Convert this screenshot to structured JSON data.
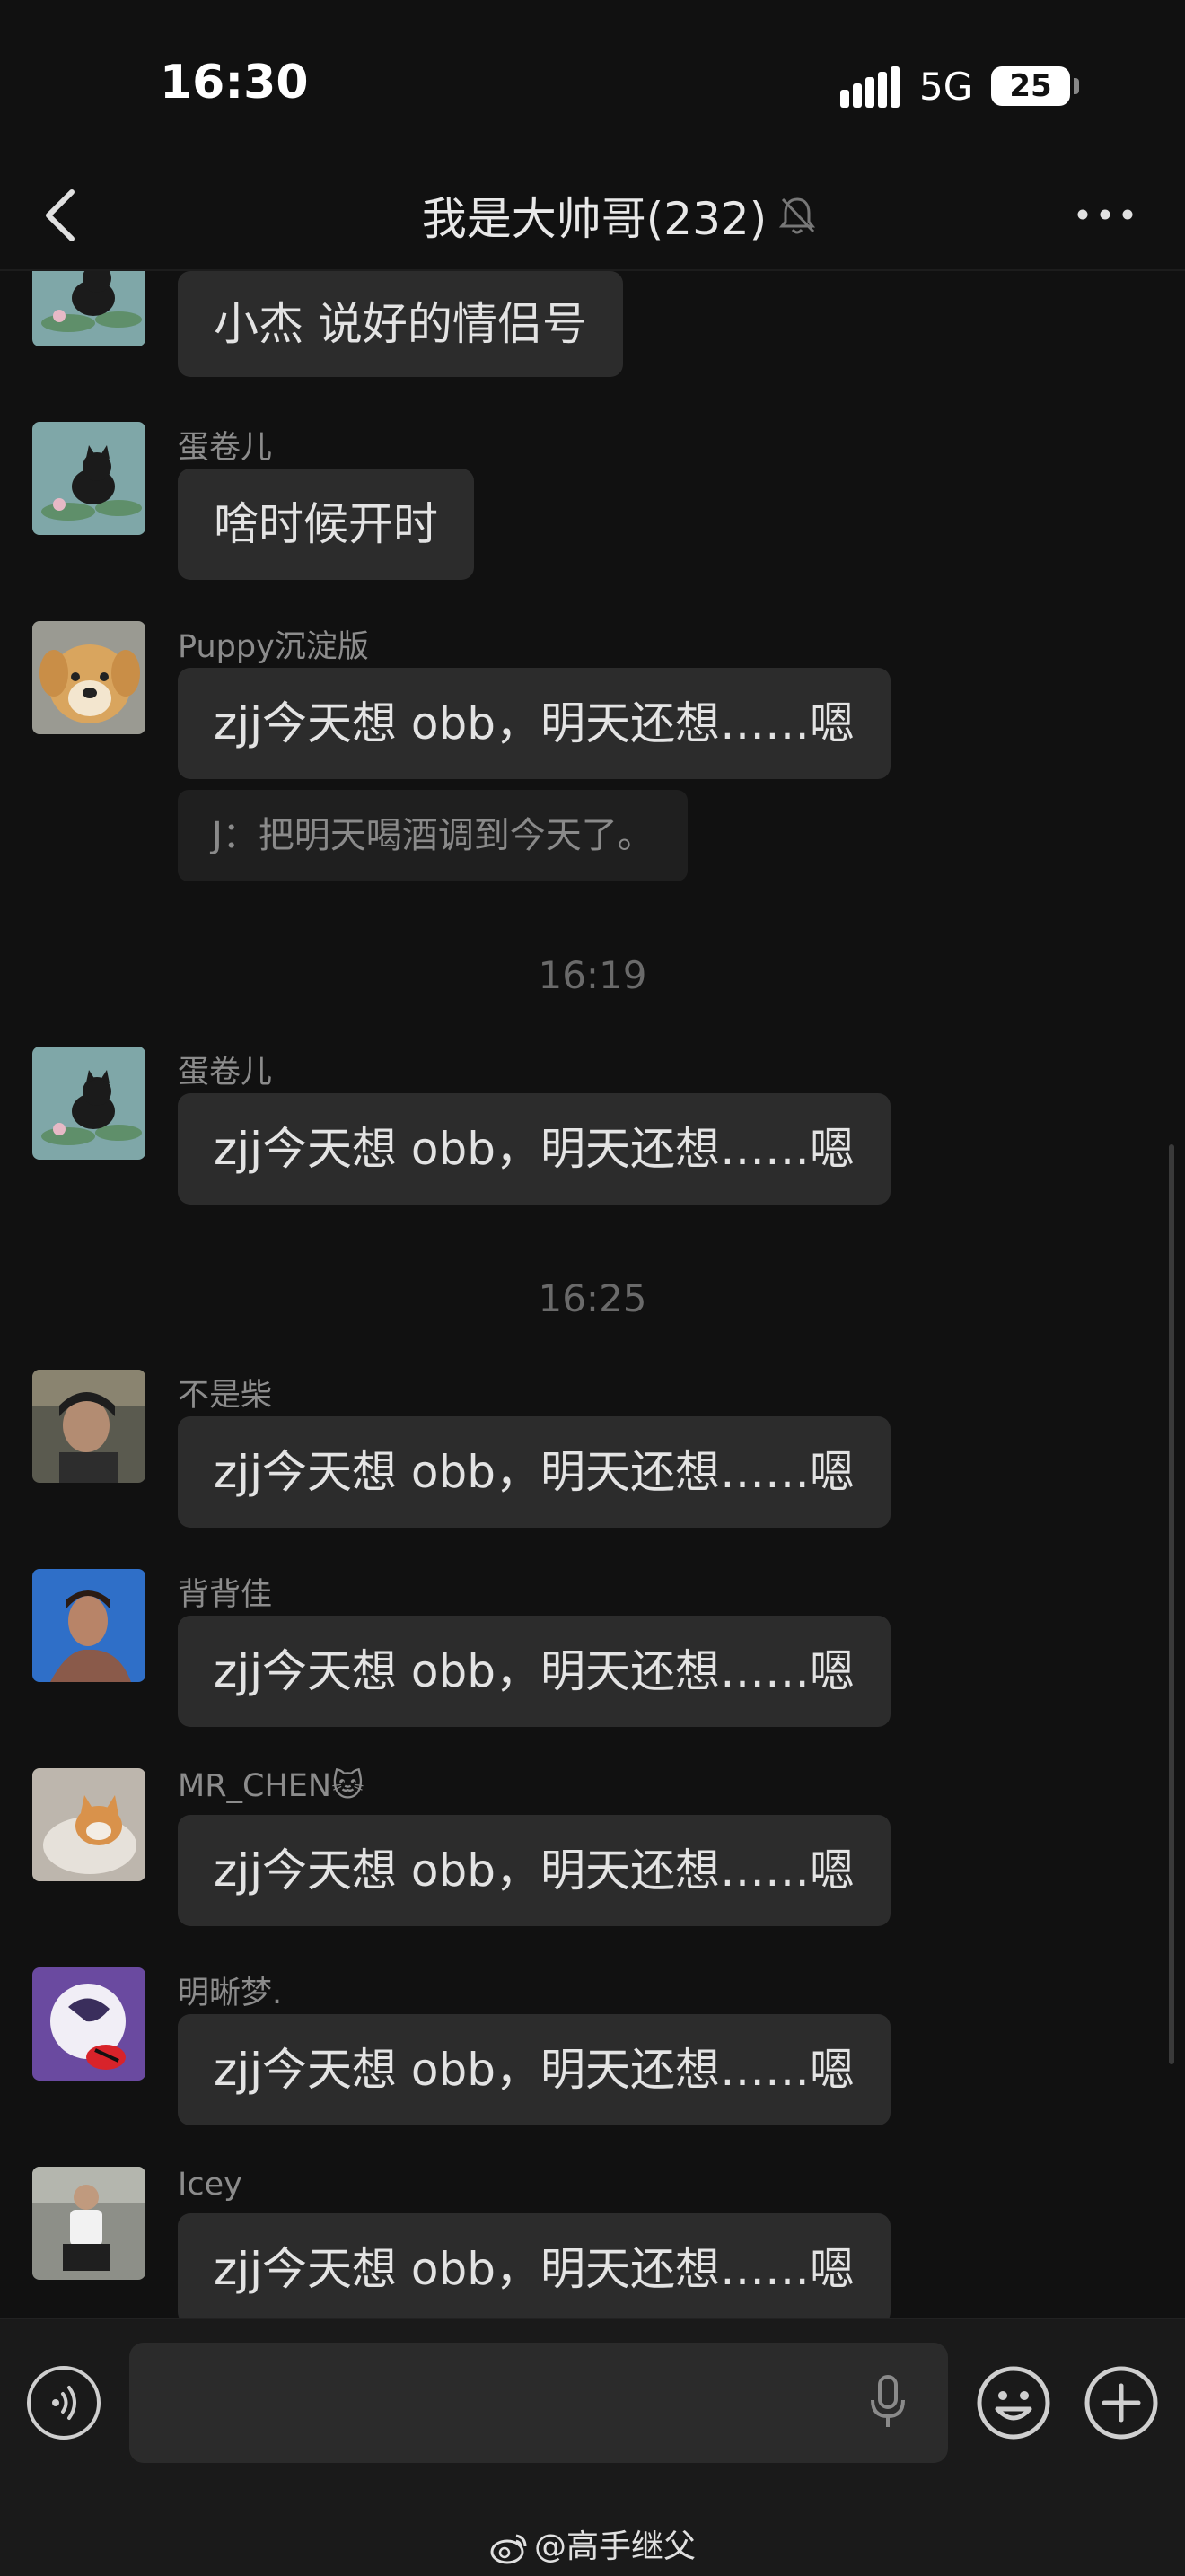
{
  "status": {
    "time": "16:30",
    "network": "5G",
    "battery": "25"
  },
  "header": {
    "title": "我是大帅哥(232)"
  },
  "messages": [
    {
      "sender": "",
      "text": "小杰 说好的情侣号",
      "avatar": "cat-on-lilypad"
    },
    {
      "sender": "蛋卷儿",
      "text": "啥时候开时",
      "avatar": "cat-on-lilypad"
    },
    {
      "sender": "Puppy沉淀版",
      "text": "zjj今天想 obb，明天还想……嗯",
      "quote": "J：把明天喝酒调到今天了。",
      "avatar": "golden-puppy"
    },
    {
      "sender": "蛋卷儿",
      "text": "zjj今天想 obb，明天还想……嗯",
      "avatar": "cat-on-lilypad"
    },
    {
      "sender": "不是柴",
      "text": "zjj今天想 obb，明天还想……嗯",
      "avatar": "person-selfie"
    },
    {
      "sender": "背背佳",
      "text": "zjj今天想 obb，明天还想……嗯",
      "avatar": "person-blue-sky"
    },
    {
      "sender": "MR_CHEN🐱",
      "text": "zjj今天想 obb，明天还想……嗯",
      "avatar": "sleeping-kitten"
    },
    {
      "sender": "明晰梦.",
      "text": "zjj今天想 obb，明天还想……嗯",
      "avatar": "purple-cartoon"
    },
    {
      "sender": "Icey",
      "text": "zjj今天想 obb，明天还想……嗯",
      "avatar": "person-sitting"
    }
  ],
  "timestamps": [
    "16:19",
    "16:25"
  ],
  "footer": {
    "watermark": "@高手继父"
  },
  "colors": {
    "background": "#111111",
    "bubble": "#2c2c2c",
    "quote": "#1f1f1f",
    "text": "#e3e3e3",
    "muted": "#8c8c8c"
  }
}
